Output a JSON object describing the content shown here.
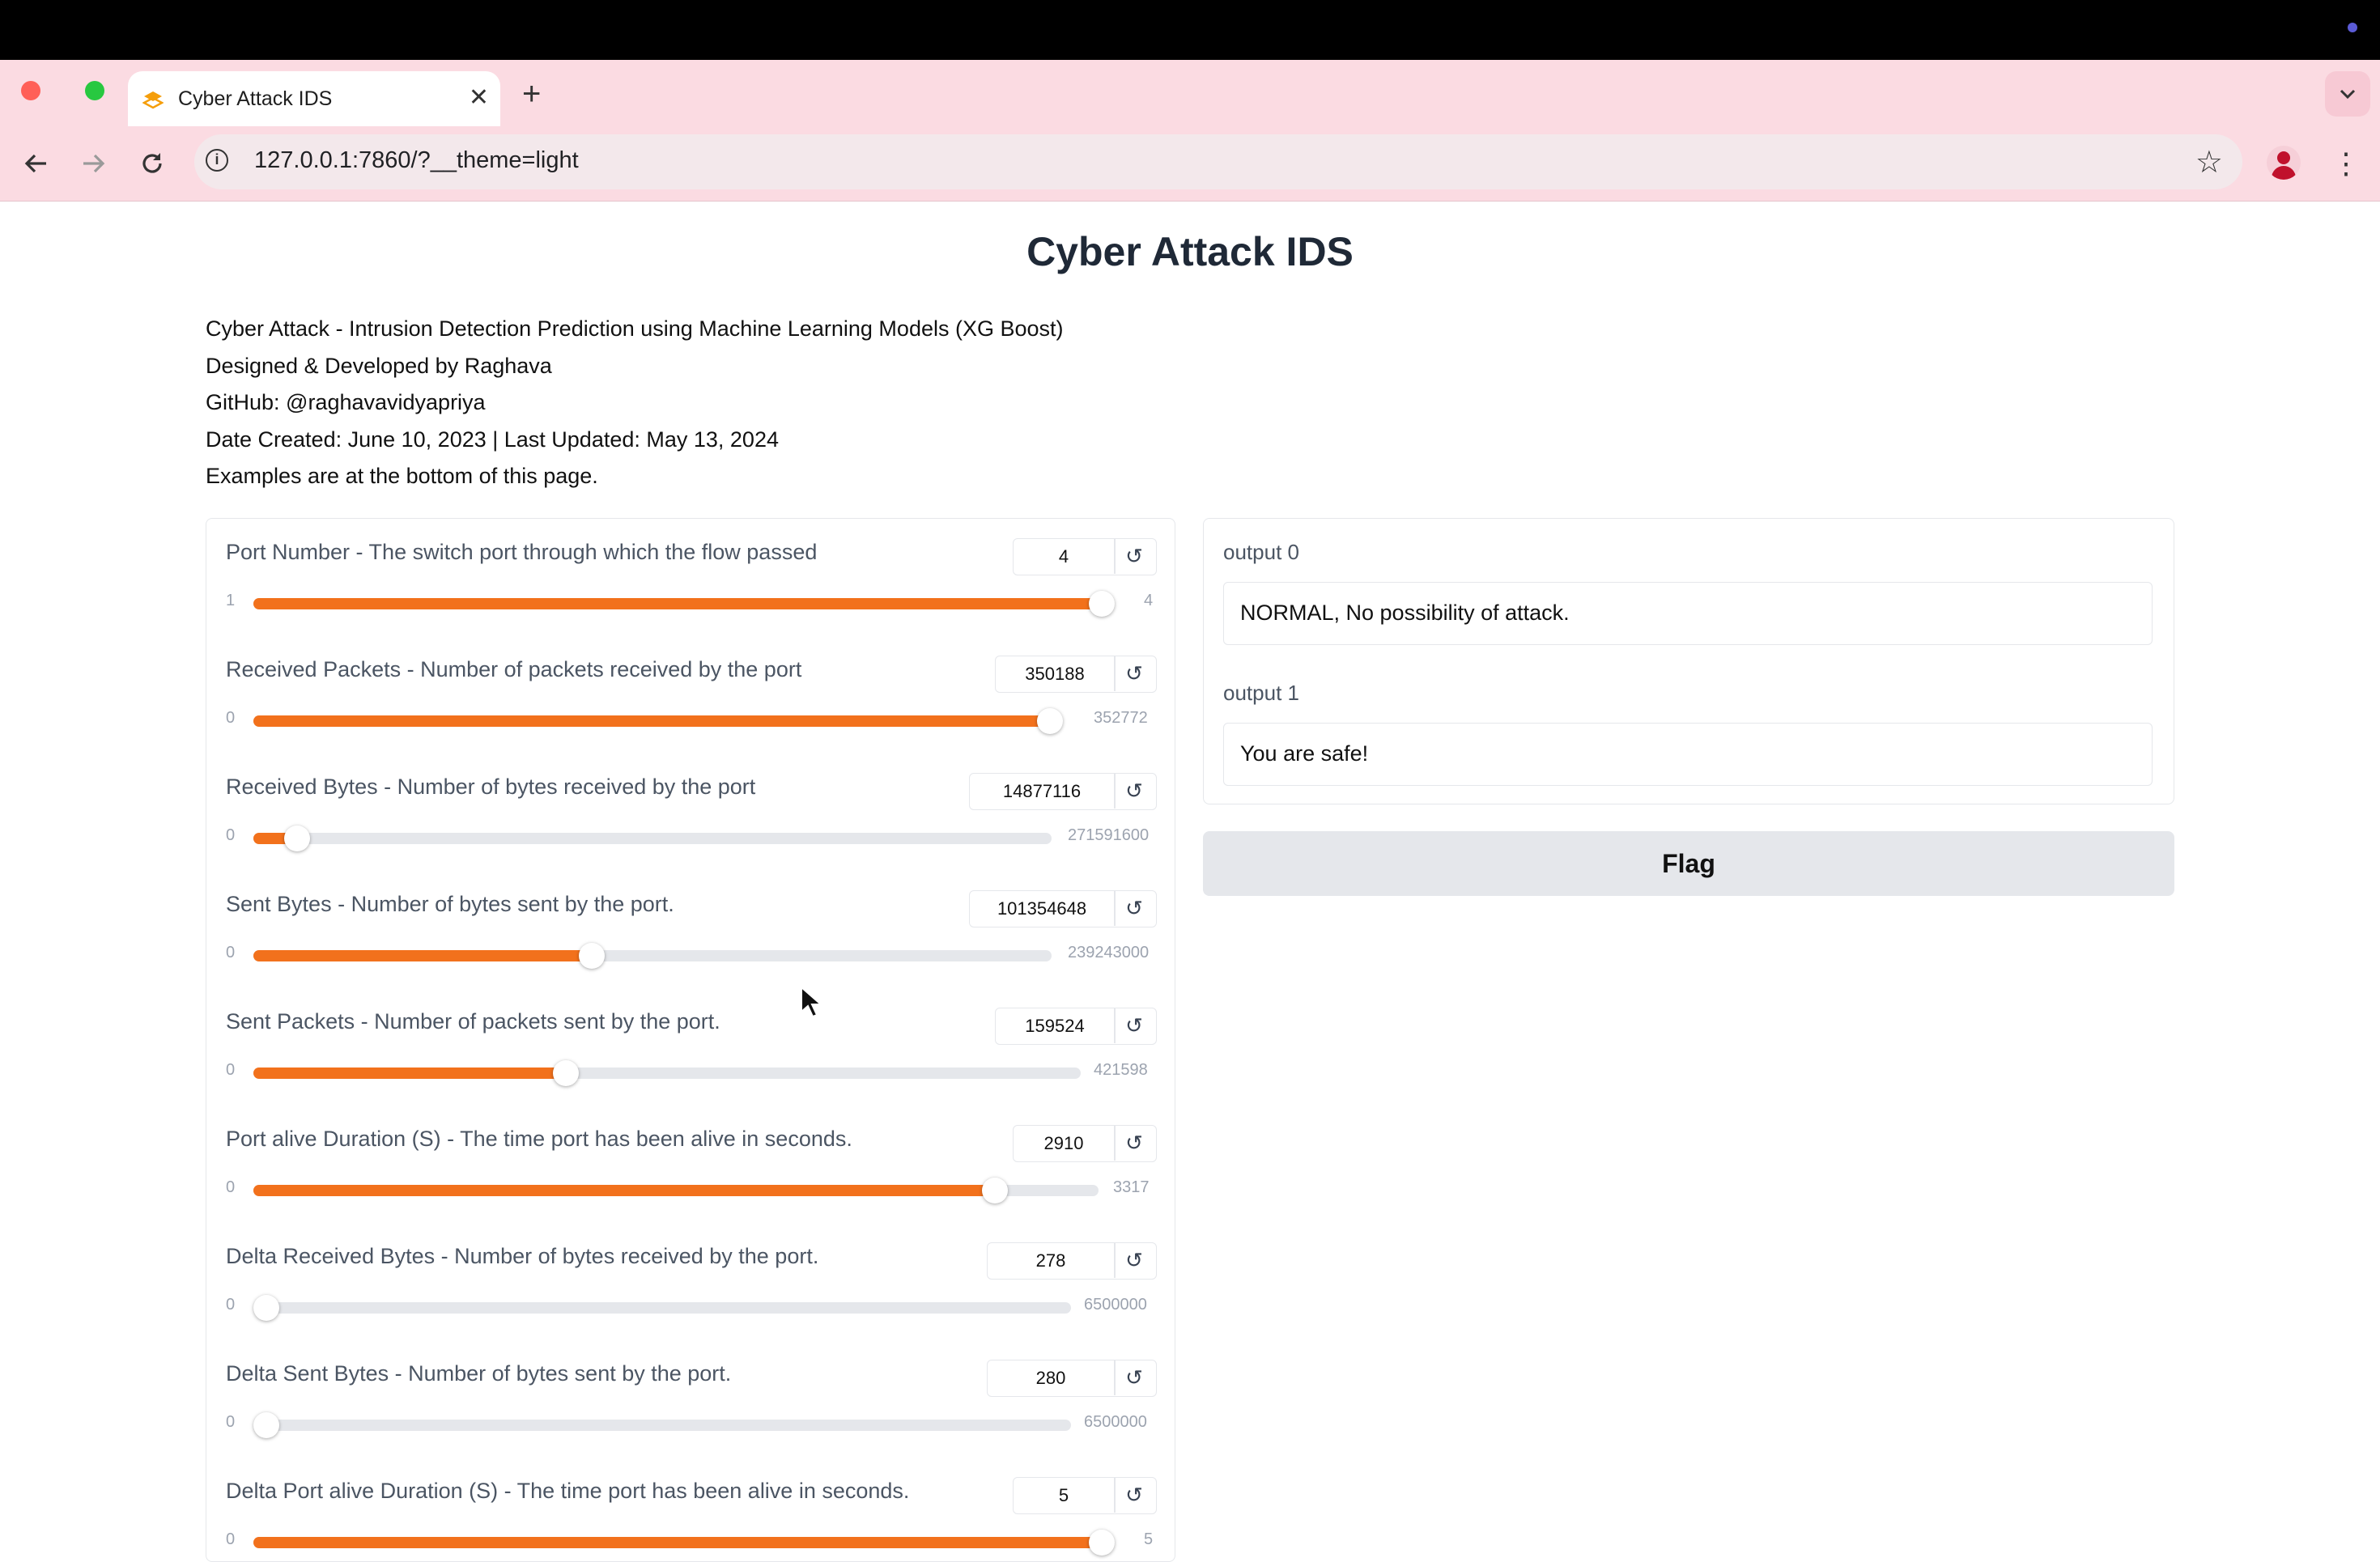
{
  "browser": {
    "tab_title": "Cyber Attack IDS",
    "tab_close": "✕",
    "new_tab": "+",
    "url": "127.0.0.1:7860/?__theme=light"
  },
  "page": {
    "title": "Cyber Attack IDS",
    "description": [
      "Cyber Attack - Intrusion Detection Prediction using Machine Learning Models (XG Boost)",
      "Designed & Developed by Raghava",
      "GitHub: @raghavavidyapriya",
      "Date Created: June 10, 2023 | Last Updated: May 13, 2024",
      "Examples are at the bottom of this page."
    ]
  },
  "inputs": [
    {
      "label": "Port Number - The switch port through which the flow passed",
      "value": "4",
      "min": "1",
      "max": "4",
      "fraction": 1.0
    },
    {
      "label": "Received Packets - Number of packets received by the port",
      "value": "350188",
      "min": "0",
      "max": "352772",
      "fraction": 0.993
    },
    {
      "label": "Received Bytes - Number of bytes received by the port",
      "value": "14877116",
      "min": "0",
      "max": "271591600",
      "fraction": 0.055
    },
    {
      "label": "Sent Bytes - Number of bytes sent by the port.",
      "value": "101354648",
      "min": "0",
      "max": "239243000",
      "fraction": 0.424
    },
    {
      "label": "Sent Packets - Number of packets sent by the port.",
      "value": "159524",
      "min": "0",
      "max": "421598",
      "fraction": 0.378
    },
    {
      "label": "Port alive Duration (S) - The time port has been alive in seconds.",
      "value": "2910",
      "min": "0",
      "max": "3317",
      "fraction": 0.877
    },
    {
      "label": "Delta Received Bytes - Number of bytes received by the port.",
      "value": "278",
      "min": "0",
      "max": "6500000",
      "fraction": 0.0
    },
    {
      "label": "Delta Sent Bytes - Number of bytes sent by the port.",
      "value": "280",
      "min": "0",
      "max": "6500000",
      "fraction": 0.0
    },
    {
      "label": "Delta Port alive Duration (S) - The time port has been alive in seconds.",
      "value": "5",
      "min": "0",
      "max": "5",
      "fraction": 1.0
    }
  ],
  "outputs": [
    {
      "label": "output 0",
      "value": "NORMAL, No possibility of attack."
    },
    {
      "label": "output 1",
      "value": "You are safe!"
    }
  ],
  "flag_label": "Flag",
  "colors": {
    "accent": "#f2711c",
    "tabstrip": "#fbdbe2",
    "track": "#e5e7eb"
  },
  "icons": [
    "back-arrow-icon",
    "forward-arrow-icon",
    "reload-icon",
    "info-icon",
    "star-icon",
    "profile-icon",
    "reset-icon",
    "chevron-down-icon"
  ]
}
